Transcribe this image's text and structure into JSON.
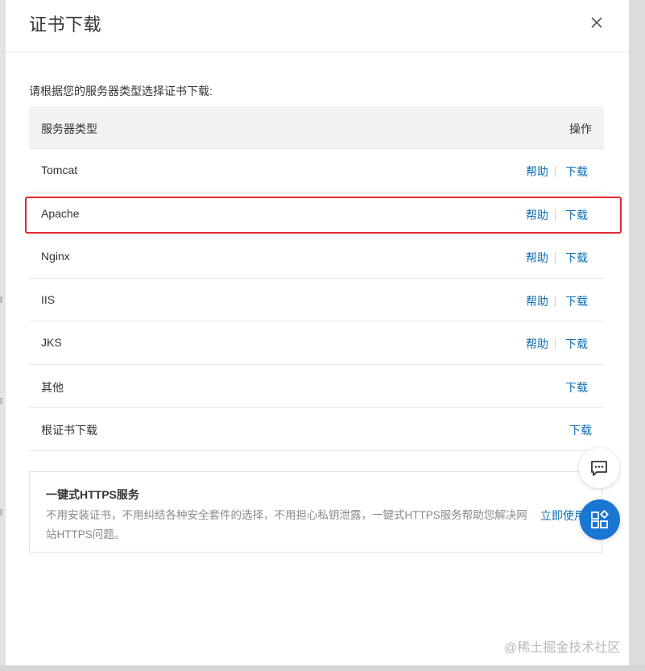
{
  "dialog": {
    "title": "证书下载",
    "close_icon": "close-icon"
  },
  "intro_text": "请根据您的服务器类型选择证书下载:",
  "table": {
    "headers": {
      "server_type": "服务器类型",
      "actions": "操作"
    },
    "rows": [
      {
        "name": "Tomcat",
        "help": "帮助",
        "download": "下载"
      },
      {
        "name": "Apache",
        "help": "帮助",
        "download": "下载"
      },
      {
        "name": "Nginx",
        "help": "帮助",
        "download": "下载"
      },
      {
        "name": "IIS",
        "help": "帮助",
        "download": "下载"
      },
      {
        "name": "JKS",
        "help": "帮助",
        "download": "下载"
      },
      {
        "name": "其他",
        "download": "下载"
      },
      {
        "name": "根证书下载",
        "download": "下载"
      }
    ],
    "highlighted_row": "Apache"
  },
  "promo": {
    "title": "一键式HTTPS服务",
    "description": "不用安装证书，不用纠结各种安全套件的选择，不用担心私钥泄露，一键式HTTPS服务帮助您解决网站HTTPS问题。",
    "cta": "立即使用"
  },
  "floating_buttons": {
    "chat_icon": "chat-bubble-icon",
    "apps_icon": "apps-grid-icon"
  },
  "watermark": "@稀土掘金技术社区",
  "colors": {
    "link": "#0f6fb5",
    "highlight_border": "#e0282e",
    "apps_button": "#1976d2",
    "header_bg": "#f2f2f2"
  }
}
